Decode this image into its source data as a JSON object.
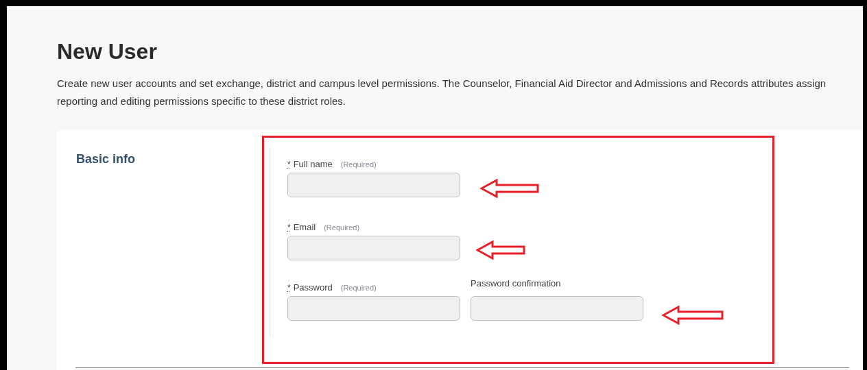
{
  "title": "New User",
  "description": "Create new user accounts and set exchange, district and campus level permissions. The Counselor, Financial Aid Director and Admissions and Records attributes assign reporting and editing permissions specific to these district roles.",
  "section": {
    "title": "Basic info",
    "rows": [
      [
        {
          "label": "Full name",
          "required": true,
          "mark": "*",
          "hint": "(Required)"
        }
      ],
      [
        {
          "label": "Email",
          "required": true,
          "mark": "*",
          "hint": "(Required)"
        }
      ],
      [
        {
          "label": "Password",
          "required": true,
          "mark": "*",
          "hint": "(Required)"
        },
        {
          "label": "Password confirmation"
        }
      ]
    ]
  }
}
